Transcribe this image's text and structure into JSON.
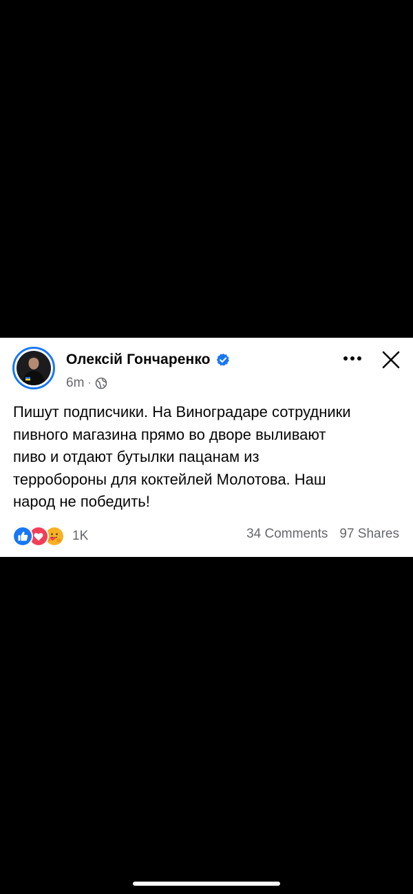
{
  "post": {
    "author_name": "Олексій Гончаренко",
    "verified": true,
    "time": "6m",
    "separator": "·",
    "audience_icon": "globe-icon",
    "text": "Пишут подписчики. На Виноградаре сотрудники\nпивного магазина прямо во дворе выливают\nпиво и отдают бутылки пацанам из\nтерробороны для коктейлей Молотова. Наш\nнарод не победить!",
    "reactions": {
      "icons": [
        "like-icon",
        "love-icon",
        "care-icon"
      ],
      "count": "1K"
    },
    "comments": "34 Comments",
    "shares": "97 Shares"
  },
  "colors": {
    "facebook_blue": "#1877f2",
    "love_red": "#f33e58",
    "care_yellow": "#f7b125",
    "secondary_text": "#65676b",
    "primary_text": "#050505"
  }
}
